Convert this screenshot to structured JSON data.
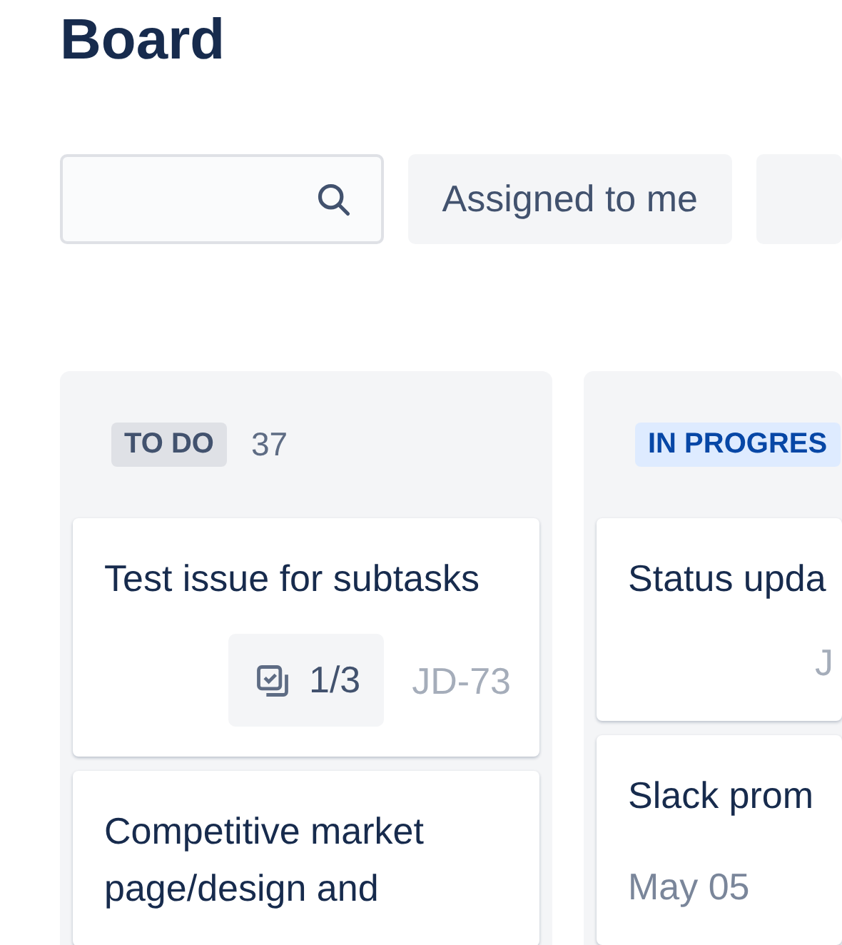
{
  "title": "Board",
  "toolbar": {
    "filters": [
      {
        "label": "Assigned to me"
      }
    ]
  },
  "columns": [
    {
      "status": "TO DO",
      "kind": "todo",
      "count": "37",
      "cards": [
        {
          "title": "Test issue for subtasks",
          "subtasks": "1/3",
          "key": "JD-73"
        },
        {
          "title": "Competitive market page/design and"
        }
      ]
    },
    {
      "status": "IN PROGRES",
      "kind": "inprogress",
      "cards": [
        {
          "title": "Status upda",
          "key": "J"
        },
        {
          "title": "Slack prom",
          "date": "May 05"
        }
      ]
    }
  ]
}
